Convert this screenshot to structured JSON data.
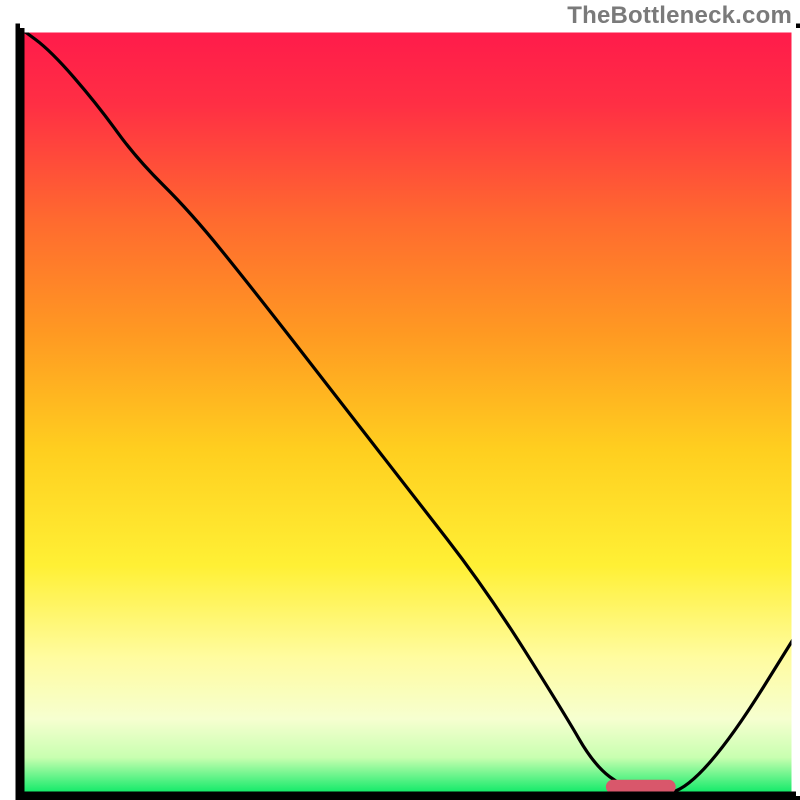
{
  "watermark": "TheBottleneck.com",
  "chart_data": {
    "type": "line",
    "title": "",
    "xlabel": "",
    "ylabel": "",
    "xlim": [
      0,
      100
    ],
    "ylim": [
      0,
      100
    ],
    "grid": false,
    "legend": false,
    "curve": {
      "name": "bottleneck-curve",
      "x": [
        0,
        4,
        10,
        15,
        22,
        30,
        40,
        50,
        60,
        70,
        74,
        78,
        82,
        86,
        92,
        100
      ],
      "y": [
        100,
        97,
        90,
        83,
        76,
        66,
        53,
        40,
        27,
        11,
        4,
        1,
        0,
        1,
        8,
        21
      ]
    },
    "optimal_marker": {
      "x_center": 80,
      "x_halfwidth": 4.5,
      "y": 1.2,
      "color": "#d9576b"
    },
    "gradient_stops": [
      {
        "offset": 0.0,
        "color": "#ff1a4b"
      },
      {
        "offset": 0.1,
        "color": "#ff2f44"
      },
      {
        "offset": 0.25,
        "color": "#ff6a2f"
      },
      {
        "offset": 0.4,
        "color": "#ff9a22"
      },
      {
        "offset": 0.55,
        "color": "#ffcf1f"
      },
      {
        "offset": 0.7,
        "color": "#fff035"
      },
      {
        "offset": 0.82,
        "color": "#fffca0"
      },
      {
        "offset": 0.9,
        "color": "#f6ffd0"
      },
      {
        "offset": 0.95,
        "color": "#c8ffb0"
      },
      {
        "offset": 1.0,
        "color": "#00e862"
      }
    ]
  }
}
